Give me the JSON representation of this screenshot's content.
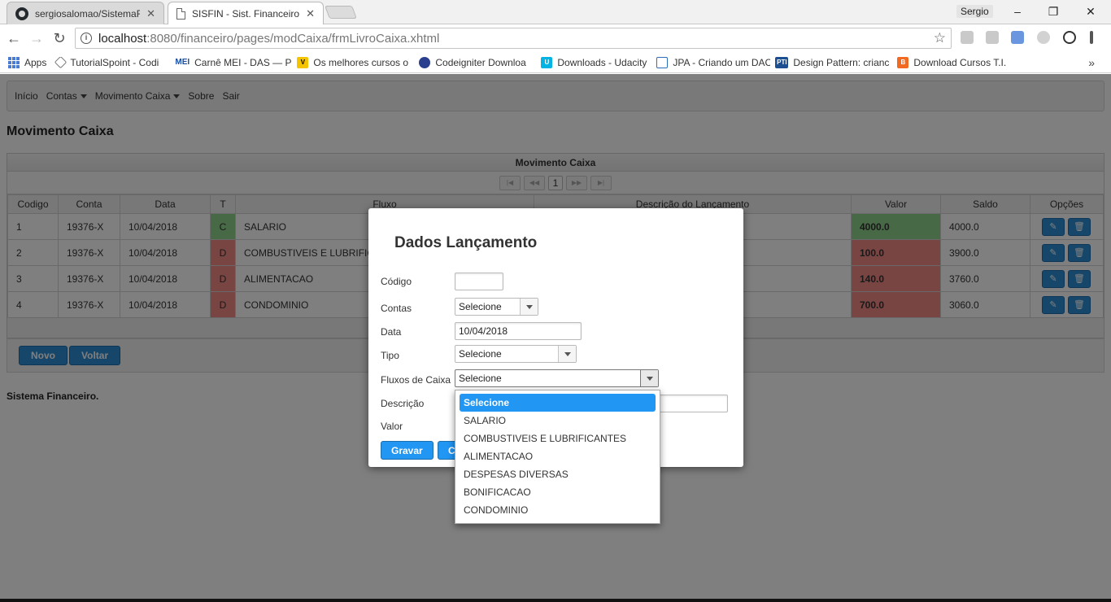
{
  "browser": {
    "tabs": [
      {
        "label": "sergiosalomao/SistemaFi",
        "icon": "github-icon"
      },
      {
        "label": "SISFIN - Sist. Financeiro",
        "icon": "page-icon"
      }
    ],
    "user": "Sergio",
    "url_host": "localhost",
    "url_path": ":8080/financeiro/pages/modCaixa/frmLivroCaixa.xhtml",
    "bookmarks": [
      {
        "label": "Apps"
      },
      {
        "label": "TutorialSpoint - Codi"
      },
      {
        "label": "Carnê MEI - DAS — P",
        "badge": "MEI"
      },
      {
        "label": "Os melhores cursos o"
      },
      {
        "label": "Codeigniter Downloa"
      },
      {
        "label": "Downloads - Udacity"
      },
      {
        "label": "JPA - Criando um DAC"
      },
      {
        "label": "Design Pattern: crianc",
        "badge": "PTI"
      },
      {
        "label": "Download Cursos T.I."
      }
    ]
  },
  "menu": {
    "items": [
      "Início",
      "Contas",
      "Movimento Caixa",
      "Sobre",
      "Sair"
    ]
  },
  "page": {
    "title": "Movimento Caixa",
    "footer": "Sistema Financeiro."
  },
  "table": {
    "header": "Movimento Caixa",
    "page_number": "1",
    "columns": [
      "Codigo",
      "Conta",
      "Data",
      "T",
      "Fluxo",
      "Descrição do Lançamento",
      "Valor",
      "Saldo",
      "Opções"
    ],
    "rows": [
      {
        "codigo": "1",
        "conta": "19376-X",
        "data": "10/04/2018",
        "tipo": "C",
        "fluxo": "SALARIO",
        "descricao": "",
        "valor": "4000.0",
        "saldo": "4000.0"
      },
      {
        "codigo": "2",
        "conta": "19376-X",
        "data": "10/04/2018",
        "tipo": "D",
        "fluxo": "COMBUSTIVEIS E LUBRIFIC",
        "descricao": "",
        "valor": "100.0",
        "saldo": "3900.0"
      },
      {
        "codigo": "3",
        "conta": "19376-X",
        "data": "10/04/2018",
        "tipo": "D",
        "fluxo": "ALIMENTACAO",
        "descricao": "",
        "valor": "140.0",
        "saldo": "3760.0"
      },
      {
        "codigo": "4",
        "conta": "19376-X",
        "data": "10/04/2018",
        "tipo": "D",
        "fluxo": "CONDOMINIO",
        "descricao": "",
        "valor": "700.0",
        "saldo": "3060.0"
      }
    ]
  },
  "actions": {
    "novo": "Novo",
    "voltar": "Voltar"
  },
  "dialog": {
    "title": "Dados Lançamento",
    "labels": {
      "codigo": "Código",
      "contas": "Contas",
      "data": "Data",
      "tipo": "Tipo",
      "fluxos": "Fluxos de Caixa",
      "descricao": "Descrição",
      "valor": "Valor"
    },
    "values": {
      "codigo": "",
      "contas": "Selecione",
      "data": "10/04/2018",
      "tipo": "Selecione",
      "fluxos": "Selecione"
    },
    "buttons": {
      "gravar": "Gravar",
      "cancelar_partial": "C"
    }
  },
  "dropdown": {
    "options": [
      "Selecione",
      "SALARIO",
      "COMBUSTIVEIS E LUBRIFICANTES",
      "ALIMENTACAO",
      "DESPESAS DIVERSAS",
      "BONIFICACAO",
      "CONDOMINIO"
    ],
    "selected_index": 0
  },
  "colors": {
    "credit": "#8fd28a",
    "debit": "#f28a86",
    "primary": "#2c8ed6",
    "dropdown_selected": "#2196f3"
  }
}
